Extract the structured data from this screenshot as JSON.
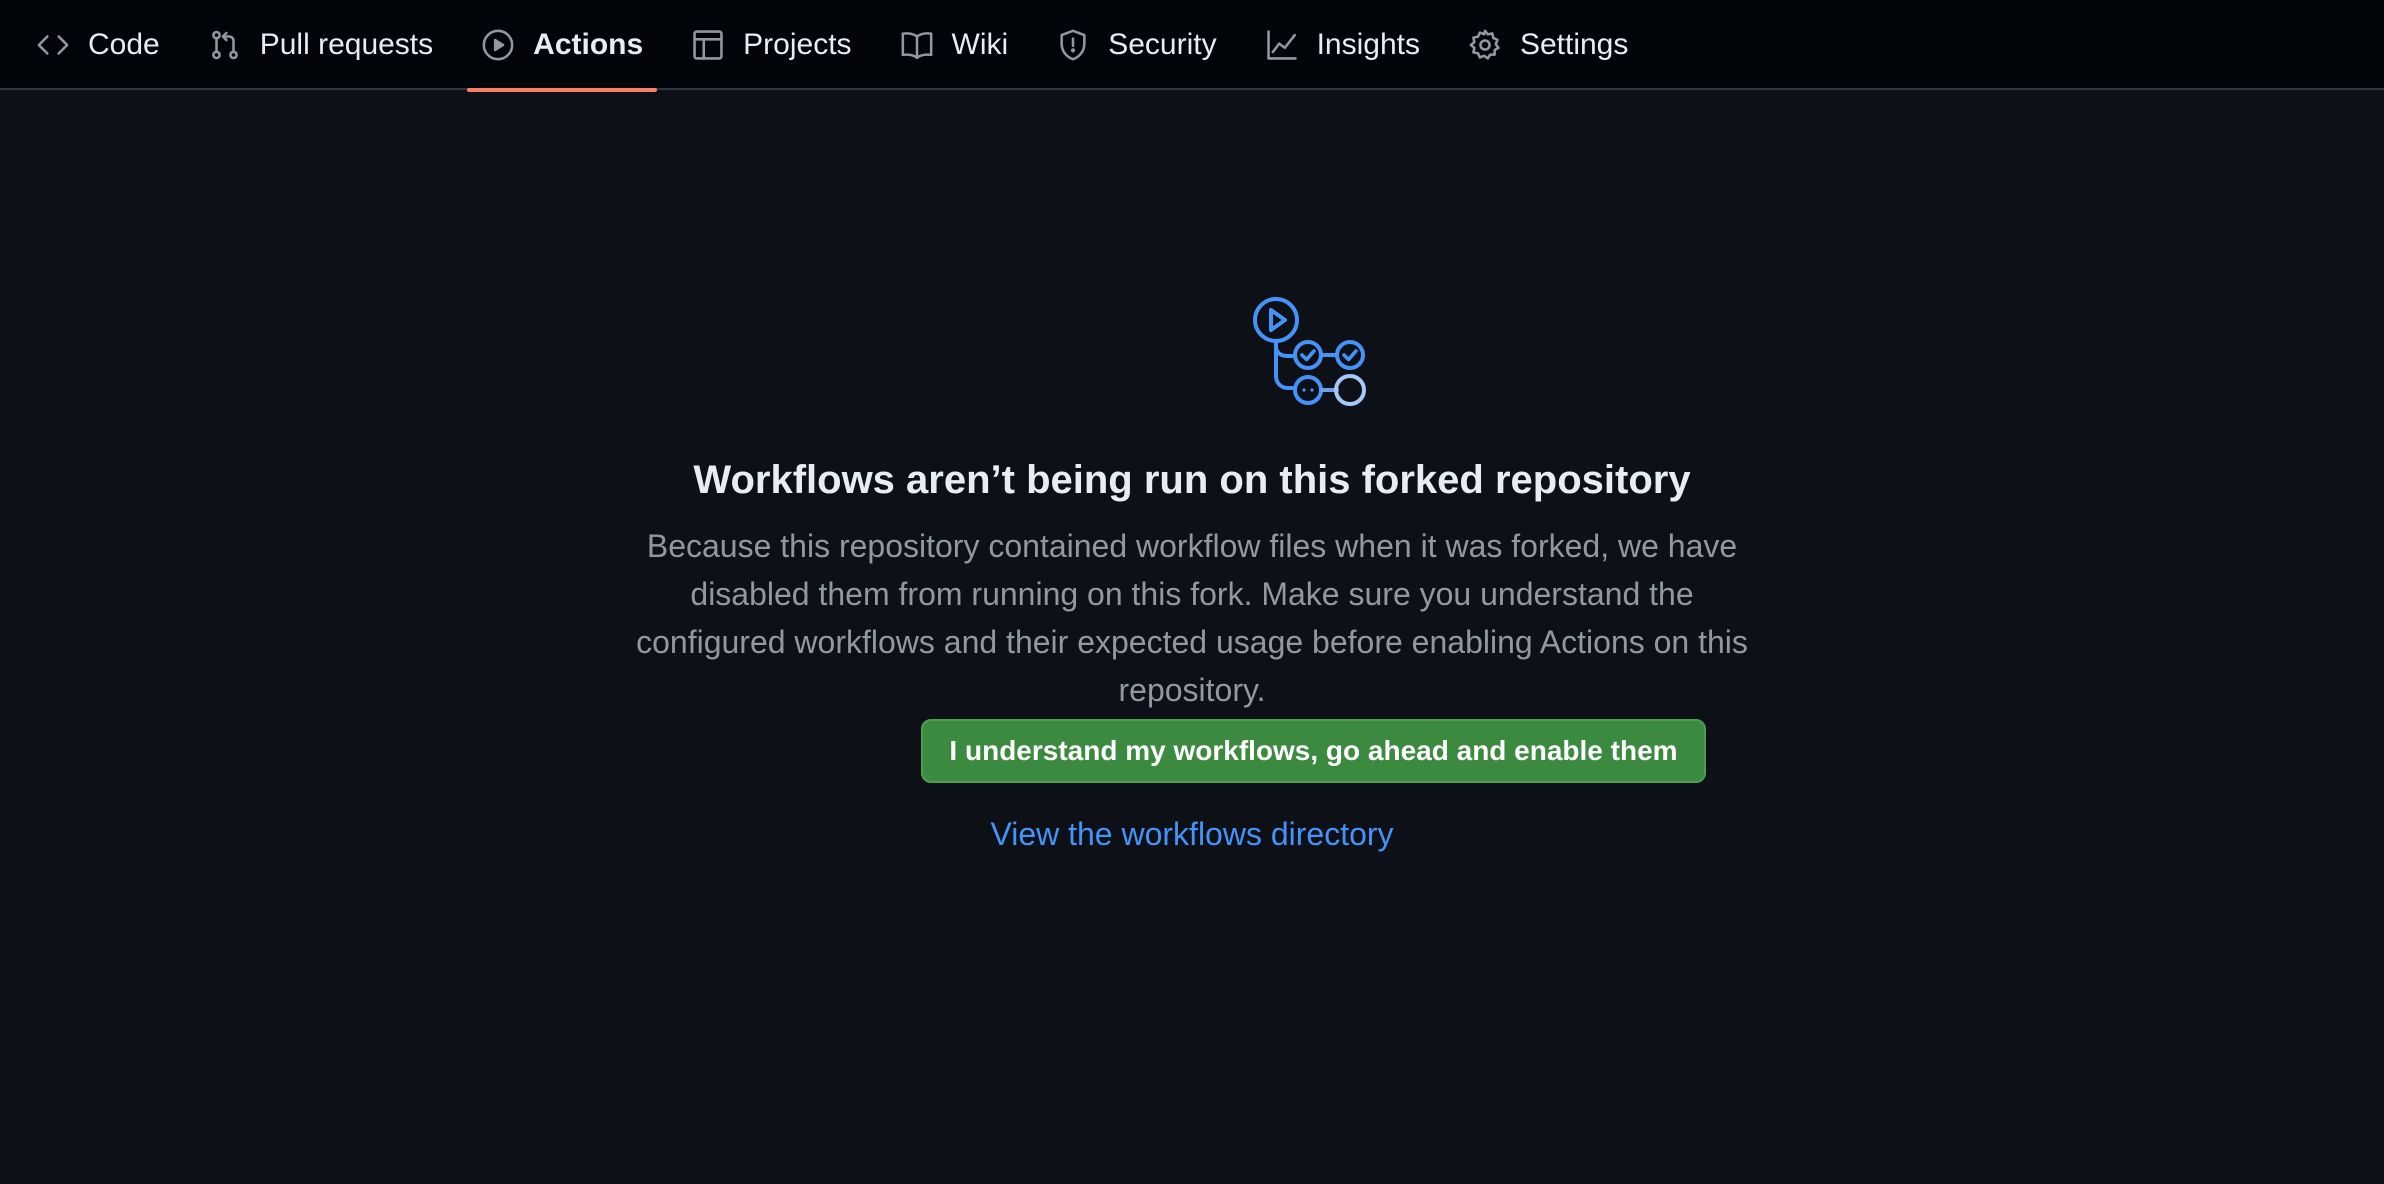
{
  "nav": {
    "tabs": [
      {
        "label": "Code",
        "icon": "code-icon"
      },
      {
        "label": "Pull requests",
        "icon": "git-pull-request-icon"
      },
      {
        "label": "Actions",
        "icon": "play-circle-icon",
        "active": true
      },
      {
        "label": "Projects",
        "icon": "table-icon"
      },
      {
        "label": "Wiki",
        "icon": "book-icon"
      },
      {
        "label": "Security",
        "icon": "shield-icon"
      },
      {
        "label": "Insights",
        "icon": "graph-icon"
      },
      {
        "label": "Settings",
        "icon": "gear-icon"
      }
    ]
  },
  "main": {
    "icon": "workflow-icon",
    "title": "Workflows aren’t being run on this forked repository",
    "description": "Because this repository contained workflow files when it was forked, we have disabled them from running on this fork. Make sure you understand the configured workflows and their expected usage before enabling Actions on this repository.",
    "enable_button": "I understand my workflows, go ahead and enable them",
    "directory_link": "View the workflows directory"
  },
  "colors": {
    "background": "#0d1117",
    "nav_background": "#010409",
    "active_underline": "#f78166",
    "button_green": "#3c8a40",
    "link_blue": "#4493f8",
    "muted_text": "#9198a1"
  }
}
